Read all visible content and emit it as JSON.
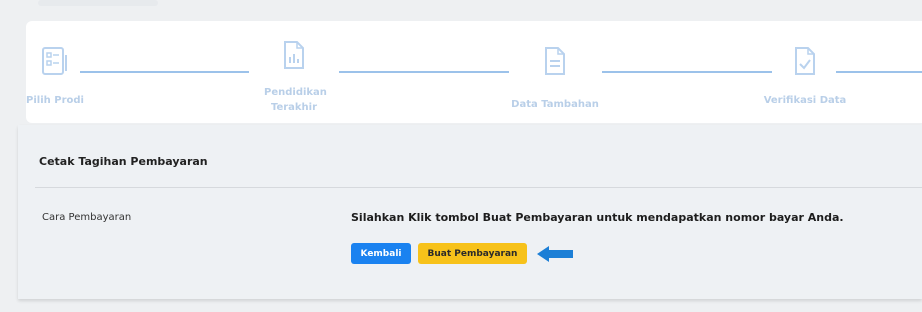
{
  "stepper": {
    "steps": [
      {
        "label": "Pilih Prodi",
        "icon": "checklist-icon"
      },
      {
        "label": "Pendidikan Terakhir",
        "icon": "report-icon"
      },
      {
        "label": "Data Tambahan",
        "icon": "document-icon"
      },
      {
        "label": "Verifikasi Data",
        "icon": "verify-document-icon"
      }
    ]
  },
  "payment": {
    "title": "Cetak Tagihan Pembayaran",
    "field_label": "Cara Pembayaran",
    "instruction": "Silahkan Klik tombol Buat Pembayaran untuk mendapatkan nomor bayar Anda.",
    "back_label": "Kembali",
    "create_label": "Buat Pembayaran"
  },
  "colors": {
    "primary": "#1a82f0",
    "warning": "#f7c21a",
    "step_inactive": "#b9cfe8",
    "arrow": "#1c7fd6"
  }
}
